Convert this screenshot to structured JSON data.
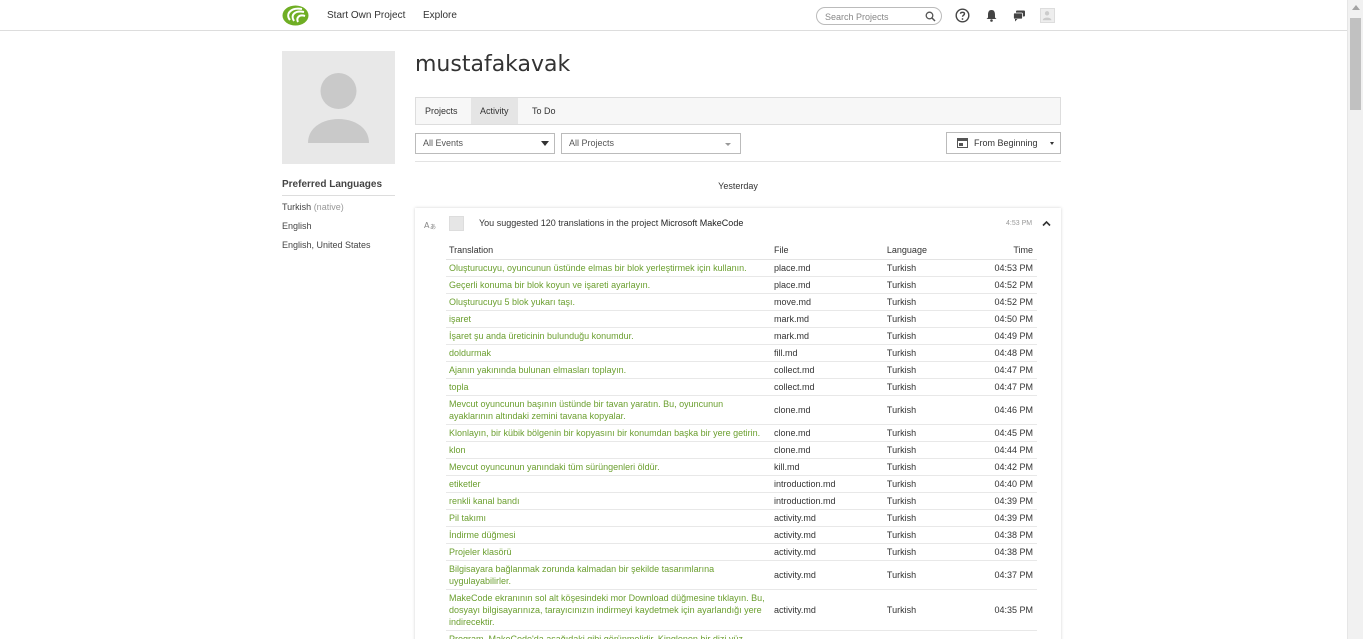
{
  "nav": {
    "start_project": "Start Own Project",
    "explore": "Explore",
    "search_placeholder": "Search Projects"
  },
  "icons": {
    "logo": "crowdin-logo",
    "help": "question-circle-icon",
    "notifications": "bell-icon",
    "messages": "chat-bubbles-icon",
    "user": "user-avatar-icon",
    "search": "magnifier-icon"
  },
  "profile": {
    "username": "mustafakavak",
    "preferred_languages_title": "Preferred Languages",
    "languages": [
      {
        "name": "Turkish",
        "note": "(native)"
      },
      {
        "name": "English",
        "note": ""
      },
      {
        "name": "English, United States",
        "note": ""
      }
    ]
  },
  "tabs": [
    {
      "label": "Projects",
      "active": false
    },
    {
      "label": "Activity",
      "active": true
    },
    {
      "label": "To Do",
      "active": false
    }
  ],
  "filters": {
    "events": "All Events",
    "projects": "All Projects",
    "range": "From Beginning"
  },
  "day_label": "Yesterday",
  "activity": {
    "text_prefix": "You suggested 120 translations in the project ",
    "project": "Microsoft MakeCode",
    "time": "4:53 PM",
    "columns": [
      "Translation",
      "File",
      "Language",
      "Time"
    ],
    "rows": [
      {
        "translation": "Oluşturucuyu, oyuncunun üstünde elmas bir blok yerleştirmek için kullanın.",
        "file": "place.md",
        "language": "Turkish",
        "time": "04:53 PM",
        "lines": 1
      },
      {
        "translation": "Geçerli konuma bir blok koyun ve işareti ayarlayın.",
        "file": "place.md",
        "language": "Turkish",
        "time": "04:52 PM",
        "lines": 1
      },
      {
        "translation": "Oluşturucuyu 5 blok yukarı taşı.",
        "file": "move.md",
        "language": "Turkish",
        "time": "04:52 PM",
        "lines": 1
      },
      {
        "translation": "işaret",
        "file": "mark.md",
        "language": "Turkish",
        "time": "04:50 PM",
        "lines": 1
      },
      {
        "translation": "İşaret şu anda üreticinin bulunduğu konumdur.",
        "file": "mark.md",
        "language": "Turkish",
        "time": "04:49 PM",
        "lines": 1
      },
      {
        "translation": "doldurmak",
        "file": "fill.md",
        "language": "Turkish",
        "time": "04:48 PM",
        "lines": 1
      },
      {
        "translation": "Ajanın yakınında bulunan elmasları toplayın.",
        "file": "collect.md",
        "language": "Turkish",
        "time": "04:47 PM",
        "lines": 1
      },
      {
        "translation": "topla",
        "file": "collect.md",
        "language": "Turkish",
        "time": "04:47 PM",
        "lines": 1
      },
      {
        "translation": "Mevcut oyuncunun başının üstünde bir tavan yaratın. Bu, oyuncunun ayaklarının altındaki zemini tavana kopyalar.",
        "file": "clone.md",
        "language": "Turkish",
        "time": "04:46 PM",
        "lines": 2
      },
      {
        "translation": "Klonlayın, bir kübik bölgenin bir kopyasını bir konumdan başka bir yere getirin.",
        "file": "clone.md",
        "language": "Turkish",
        "time": "04:45 PM",
        "lines": 1
      },
      {
        "translation": "klon",
        "file": "clone.md",
        "language": "Turkish",
        "time": "04:44 PM",
        "lines": 1
      },
      {
        "translation": "Mevcut oyuncunun yanındaki tüm sürüngenleri öldür.",
        "file": "kill.md",
        "language": "Turkish",
        "time": "04:42 PM",
        "lines": 1
      },
      {
        "translation": "etiketler",
        "file": "introduction.md",
        "language": "Turkish",
        "time": "04:40 PM",
        "lines": 1
      },
      {
        "translation": "renkli kanal bandı",
        "file": "introduction.md",
        "language": "Turkish",
        "time": "04:39 PM",
        "lines": 1
      },
      {
        "translation": "Pil takımı",
        "file": "activity.md",
        "language": "Turkish",
        "time": "04:39 PM",
        "lines": 1
      },
      {
        "translation": "İndirme düğmesi",
        "file": "activity.md",
        "language": "Turkish",
        "time": "04:38 PM",
        "lines": 1
      },
      {
        "translation": "Projeler klasörü",
        "file": "activity.md",
        "language": "Turkish",
        "time": "04:38 PM",
        "lines": 1
      },
      {
        "translation": "Bilgisayara bağlanmak zorunda kalmadan bir şekilde tasarımlarına uygulayabilirler.",
        "file": "activity.md",
        "language": "Turkish",
        "time": "04:37 PM",
        "lines": 2
      },
      {
        "translation": "MakeCode ekranının sol alt köşesindeki mor Download düğmesine tıklayın. Bu, dosyayı bilgisayarınıza, tarayıcınızın indirmeyi kaydetmek için ayarlandığı yere indirecektir.",
        "file": "activity.md",
        "language": "Turkish",
        "time": "04:35 PM",
        "lines": 3
      },
      {
        "translation": "Program, MakeCode'da aşağıdaki gibi görünmelidir. Kinglenen bir dizi yüz",
        "file": "",
        "language": "",
        "time": "",
        "lines": 1
      }
    ]
  },
  "colors": {
    "link_green": "#6b9f2f",
    "tab_active": "#e5e5e5",
    "border": "#dddddd"
  }
}
